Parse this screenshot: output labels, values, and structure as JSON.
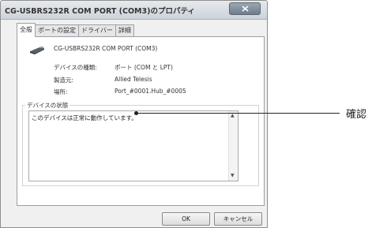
{
  "window": {
    "title": "CG-USBRS232R COM PORT (COM3)のプロパティ"
  },
  "tabs": [
    {
      "label": "全般"
    },
    {
      "label": "ポートの設定"
    },
    {
      "label": "ドライバー"
    },
    {
      "label": "詳細"
    }
  ],
  "device": {
    "icon": "usb-serial-device-icon",
    "name": "CG-USBRS232R COM PORT (COM3)"
  },
  "info": [
    {
      "label": "デバイスの種類:",
      "value": "ポート (COM と LPT)"
    },
    {
      "label": "製造元:",
      "value": "Allied Telesis"
    },
    {
      "label": "場所:",
      "value": "Port_#0001.Hub_#0005"
    }
  ],
  "status": {
    "group_label": "デバイスの状態",
    "text": "このデバイスは正常に動作しています。"
  },
  "buttons": {
    "ok": "OK",
    "cancel": "キャンセル"
  },
  "callout": {
    "label": "確認"
  }
}
